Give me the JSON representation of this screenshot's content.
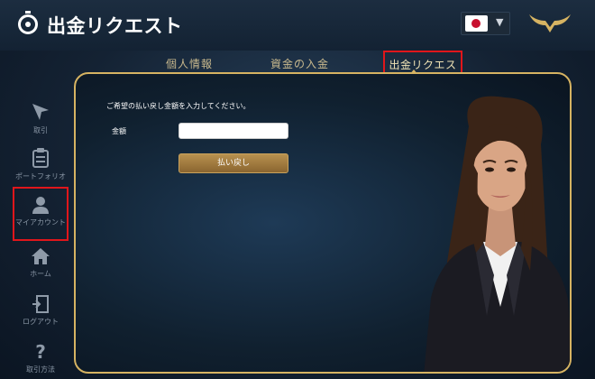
{
  "header": {
    "title": "出金リクエスト",
    "app_icon": "stopwatch-icon",
    "language_flag": "japan-flag-icon",
    "logo": "bull-horns-logo"
  },
  "tabs": [
    {
      "label": "個人情報",
      "active": false
    },
    {
      "label": "資金の入金",
      "active": false
    },
    {
      "label": "出金リクエスト",
      "active": true
    }
  ],
  "sidebar": {
    "items": [
      {
        "label": "取引",
        "icon": "cursor-icon",
        "highlighted": false
      },
      {
        "label": "ポートフォリオ",
        "icon": "clipboard-icon",
        "highlighted": false
      },
      {
        "label": "マイアカウント",
        "icon": "user-icon",
        "highlighted": true
      },
      {
        "label": "ホーム",
        "icon": "home-icon",
        "highlighted": false
      },
      {
        "label": "ログアウト",
        "icon": "logout-icon",
        "highlighted": false
      },
      {
        "label": "取引方法",
        "icon": "question-icon",
        "highlighted": false
      }
    ]
  },
  "form": {
    "instruction": "ご希望の払い戻し金額を入力してください。",
    "amount_label": "金額",
    "amount_value": "",
    "submit_label": "払い戻し"
  },
  "colors": {
    "accent_gold": "#d6b362",
    "highlight_red": "#e0161b",
    "button_brown": "#8a6530"
  }
}
